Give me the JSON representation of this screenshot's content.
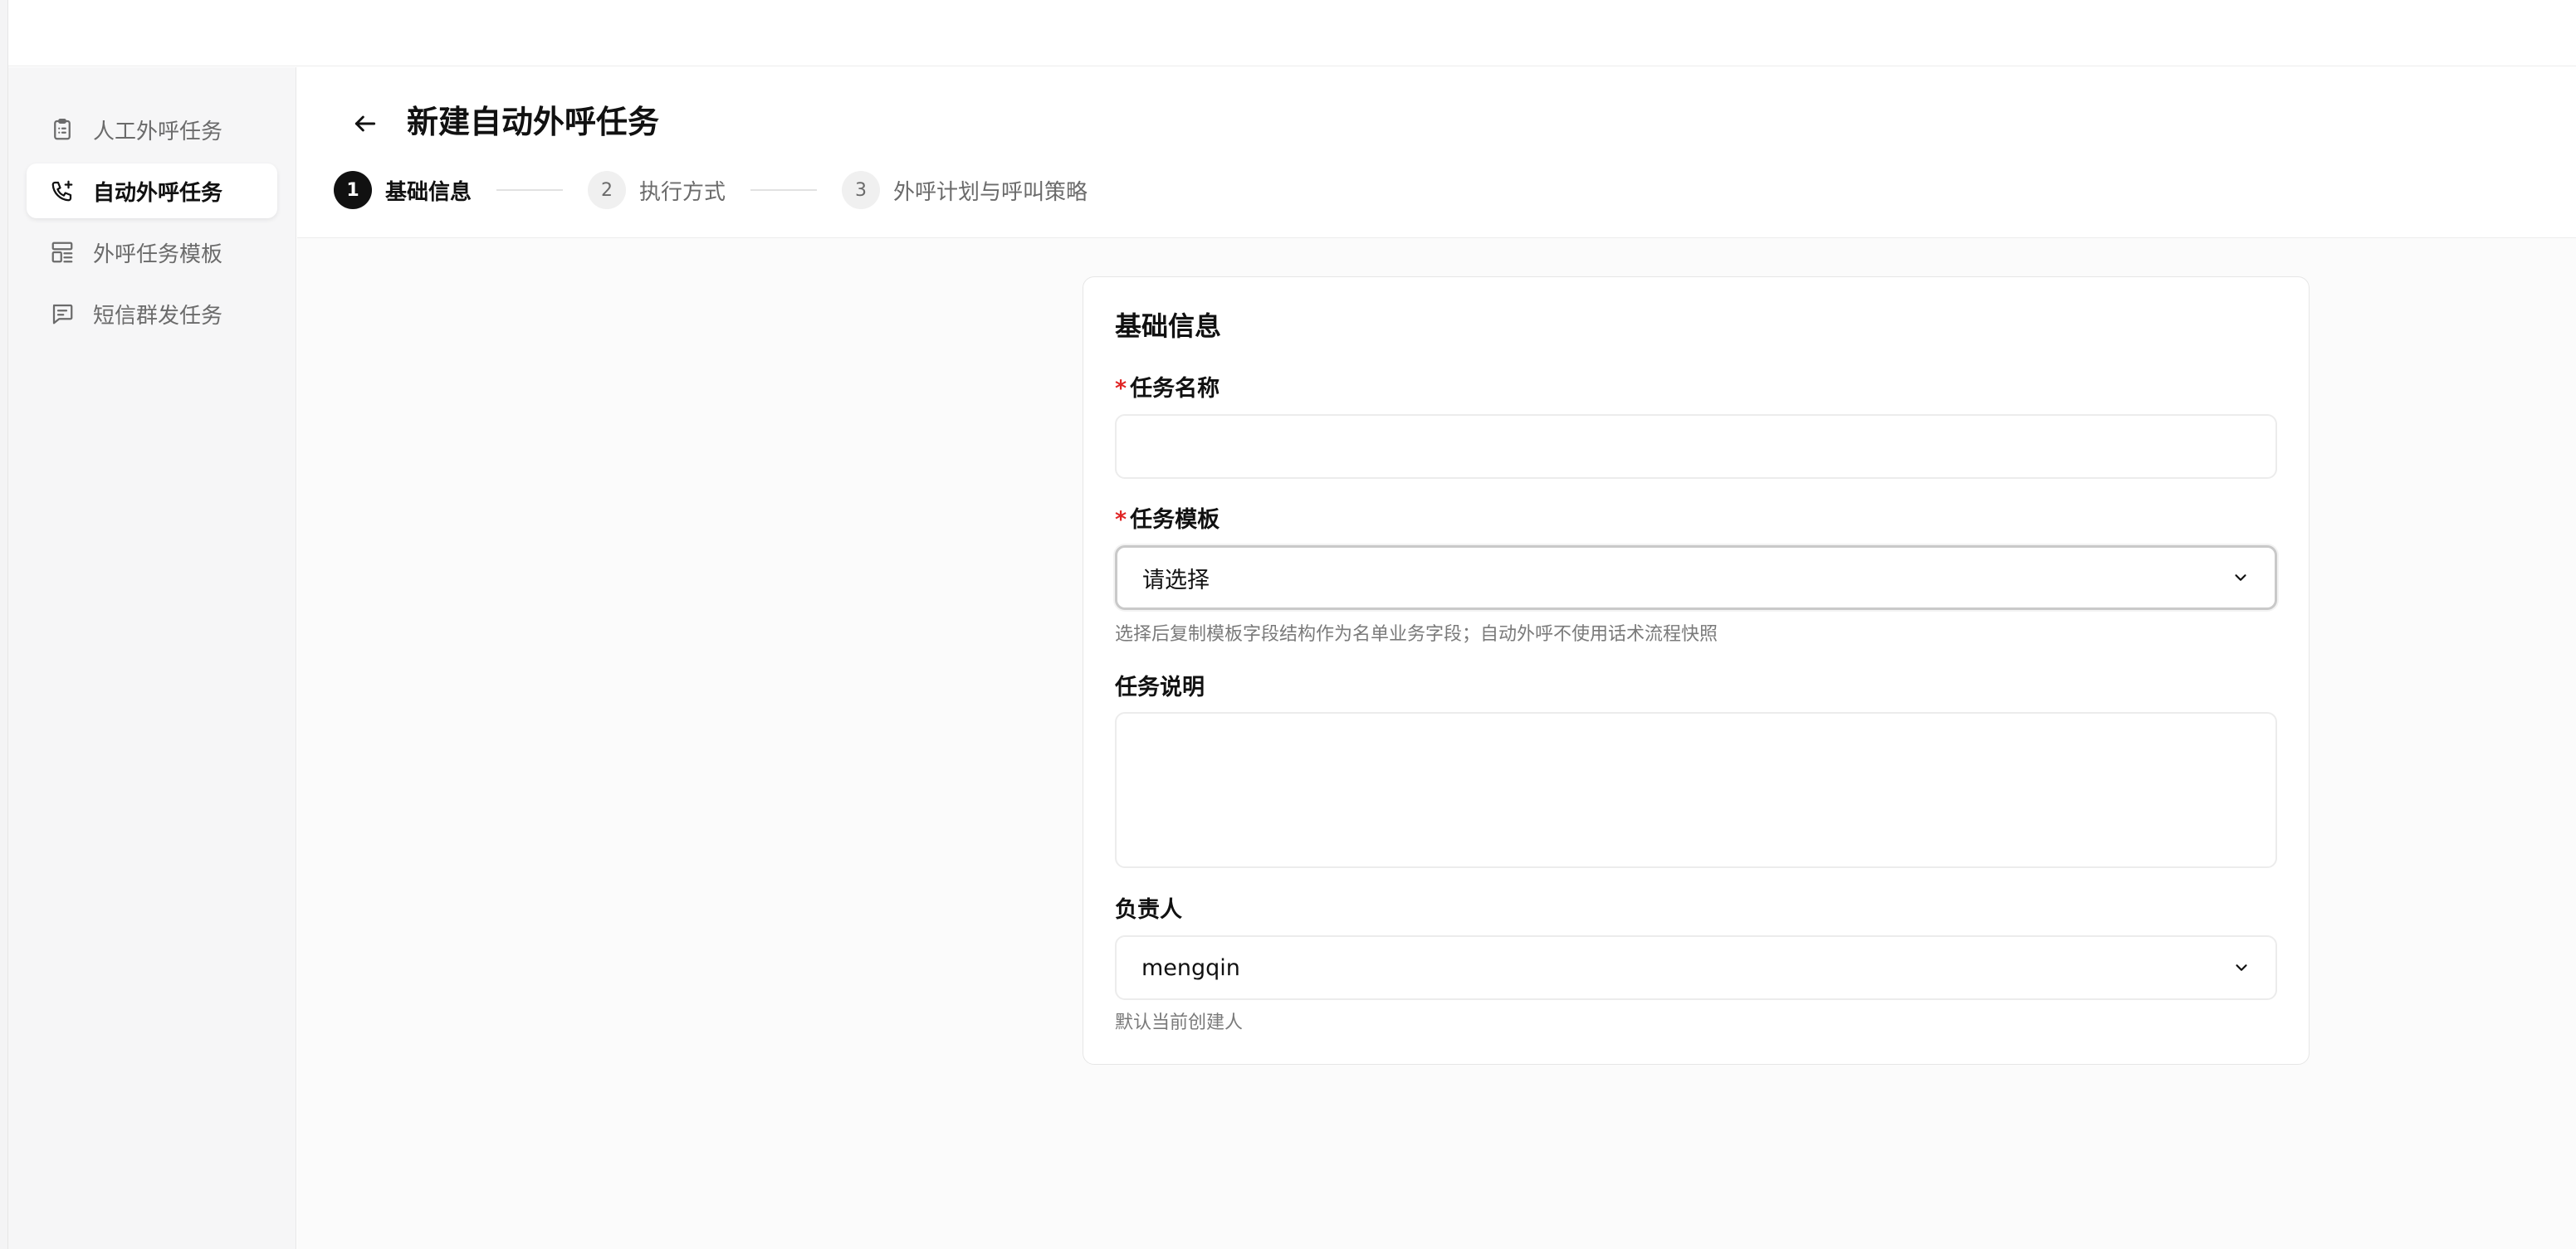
{
  "sidebar": {
    "items": [
      {
        "label": "人工外呼任务",
        "icon": "clipboard-icon",
        "active": false
      },
      {
        "label": "自动外呼任务",
        "icon": "phone-call-icon",
        "active": true
      },
      {
        "label": "外呼任务模板",
        "icon": "layout-template-icon",
        "active": false
      },
      {
        "label": "短信群发任务",
        "icon": "message-square-icon",
        "active": false
      }
    ]
  },
  "header": {
    "title": "新建自动外呼任务",
    "back_icon": "arrow-left-icon"
  },
  "steps": [
    {
      "number": "1",
      "label": "基础信息",
      "active": true
    },
    {
      "number": "2",
      "label": "执行方式",
      "active": false
    },
    {
      "number": "3",
      "label": "外呼计划与呼叫策略",
      "active": false
    }
  ],
  "form": {
    "section_title": "基础信息",
    "required_mark": "*",
    "task_name": {
      "label": "任务名称",
      "value": "",
      "placeholder": ""
    },
    "task_template": {
      "label": "任务模板",
      "selected": "请选择",
      "hint": "选择后复制模板字段结构作为名单业务字段；自动外呼不使用话术流程快照"
    },
    "task_description": {
      "label": "任务说明",
      "value": ""
    },
    "owner": {
      "label": "负责人",
      "selected": "mengqin",
      "hint": "默认当前创建人"
    }
  },
  "colors": {
    "accent": "#111111",
    "required": "#e02424",
    "muted": "#6b6b6b"
  }
}
